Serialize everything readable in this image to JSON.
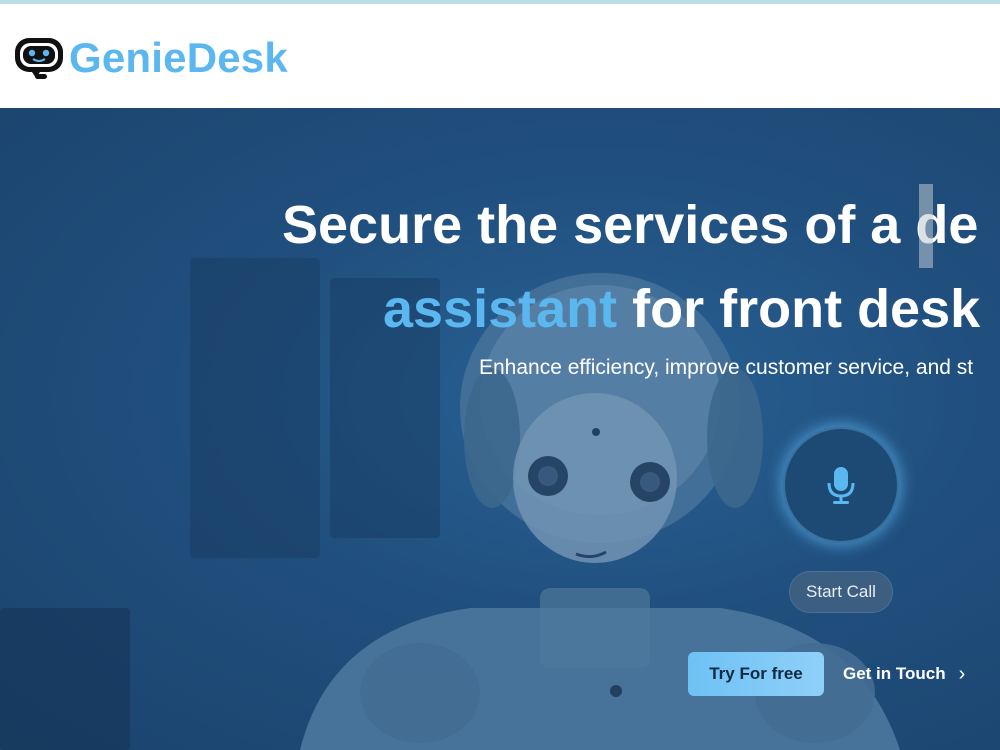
{
  "header": {
    "brand_name": "GenieDesk",
    "logo_icon": "robot-chat-icon"
  },
  "hero": {
    "headline_line1": "Secure the services of a de",
    "headline_line2_accent": "assistant",
    "headline_line2_rest": " for front desk",
    "subheadline": "Enhance efficiency, improve customer service, and st",
    "mic_icon": "microphone-icon",
    "start_call_label": "Start Call",
    "try_free_label": "Try For free",
    "get_in_touch_label": "Get in Touch",
    "get_in_touch_icon": "chevron-right-icon"
  },
  "colors": {
    "brand_blue": "#5bb7ef",
    "hero_overlay": "#234f7d",
    "button_gradient_start": "#6ec1f5",
    "button_text": "#0f2a44"
  }
}
